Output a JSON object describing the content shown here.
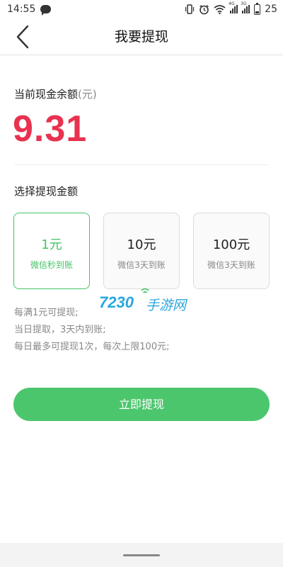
{
  "status_bar": {
    "time": "14:55",
    "battery": "25",
    "signal_tags": [
      "4G",
      "3G"
    ]
  },
  "nav": {
    "title": "我要提现"
  },
  "balance": {
    "label": "当前现金余额",
    "unit": "(元)",
    "value": "9.31"
  },
  "select": {
    "label": "选择提现金额",
    "options": [
      {
        "amount": "1元",
        "desc": "微信秒到账",
        "selected": true
      },
      {
        "amount": "10元",
        "desc": "微信3天到账",
        "selected": false
      },
      {
        "amount": "100元",
        "desc": "微信3天到账",
        "selected": false
      }
    ]
  },
  "rules": [
    "每满1元可提现;",
    "当日提取，3天内到账;",
    "每日最多可提现1次，每次上限100元;"
  ],
  "submit": {
    "label": "立即提现"
  },
  "watermark": {
    "number": "7230",
    "text": "手游网"
  },
  "colors": {
    "accent_green": "#43c466",
    "button_green": "#4cc66d",
    "balance_red": "#e8324f",
    "watermark_blue": "#29a6e0"
  },
  "icons": {
    "status_left": [
      "chat-icon"
    ],
    "status_right": [
      "vibrate-icon",
      "alarm-icon",
      "wifi-icon",
      "signal-4g-icon",
      "signal-3g-icon",
      "battery-icon"
    ],
    "nav": "back-arrow-icon"
  }
}
